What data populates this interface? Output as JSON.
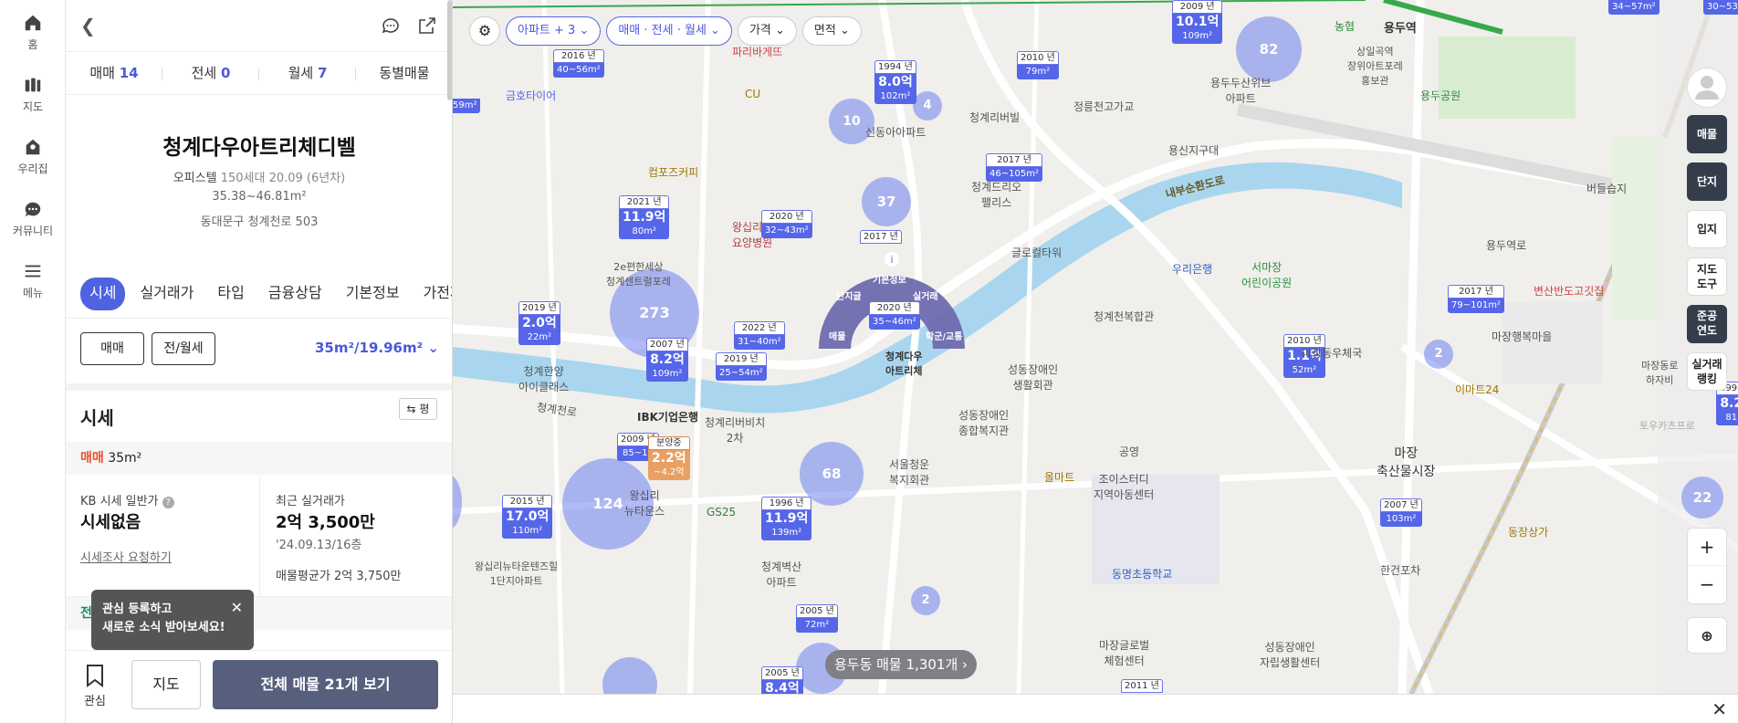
{
  "nav": [
    {
      "label": "홈",
      "icon": "home-icon"
    },
    {
      "label": "지도",
      "icon": "map-icon"
    },
    {
      "label": "우리집",
      "icon": "my-home-icon"
    },
    {
      "label": "커뮤니티",
      "icon": "community-icon"
    },
    {
      "label": "메뉴",
      "icon": "menu-icon"
    }
  ],
  "panel": {
    "deal_tabs": [
      {
        "label": "매매",
        "count": "14"
      },
      {
        "label": "전세",
        "count": "0"
      },
      {
        "label": "월세",
        "count": "7"
      },
      {
        "label": "동별매물",
        "count": ""
      }
    ],
    "title": "청계다우아트리체디벨",
    "meta_type": "오피스텔",
    "meta_rest": "150세대  20.09 (6년차)",
    "area_range": "35.38~46.81m²",
    "address": "동대문구 청계천로 503",
    "info_tabs": [
      "시세",
      "실거래가",
      "타입",
      "금융상담",
      "기본정보",
      "가전제"
    ],
    "btn_sale": "매매",
    "btn_rent": "전/월세",
    "area_select": "35m²/19.96m²",
    "section_title": "시세",
    "pyeong_btn": "평",
    "deal_row_label": "매매",
    "deal_row_area": "35m²",
    "kb_label": "KB 시세 일반가",
    "kb_value": "시세없음",
    "kb_link": "시세조사 요청하기",
    "recent_label": "최근 실거래가",
    "recent_value": "2억 3,500만",
    "recent_date": "'24.09.13/16층",
    "avg_label": "매물평균가",
    "avg_value": "2억 3,750만",
    "rent_row_label": "전세",
    "tooltip_line1": "관심 등록하고",
    "tooltip_line2": "새로운 소식 받아보세요!",
    "fav_label": "관심",
    "map_button": "지도",
    "all_button": "전체 매물 21개 보기"
  },
  "map": {
    "filters": [
      "아파트 + 3",
      "매매 · 전세 · 월세",
      "가격",
      "면적"
    ],
    "right_tools": [
      "매물",
      "단지",
      "입지",
      "지도\n도구",
      "준공\n연도",
      "실거래\n랭킹"
    ],
    "count_pill": "용두동 매물 1,301개",
    "fan_items": [
      "기본정보",
      "단지글",
      "실거래",
      "매물",
      "학군/교통"
    ],
    "fan_center_year": "2020 년",
    "fan_center_area": "35~46m²",
    "selected_name": "청계다우\n아트리체",
    "markers": [
      {
        "year": "2021 년",
        "price": "11.9억",
        "area": "80m²"
      },
      {
        "year": "2019 년",
        "price": "2.0억",
        "area": "22m²"
      },
      {
        "year": "2007 년",
        "price": "8.2억",
        "area": "109m²"
      },
      {
        "year": "2019 년",
        "price": "",
        "area": "25~54m²"
      },
      {
        "year": "2022 년",
        "price": "",
        "area": "31~40m²"
      },
      {
        "year": "2020 년",
        "price": "",
        "area": "32~43m²"
      },
      {
        "year": "1994 년",
        "price": "8.0억",
        "area": "102m²"
      },
      {
        "year": "2009 년",
        "price": "10.1억",
        "area": "109m²"
      },
      {
        "year": "2010 년",
        "price": "",
        "area": "79m²"
      },
      {
        "year": "2017 년",
        "price": "",
        "area": "46~105m²"
      },
      {
        "year": "2017 년",
        "price": "",
        "area": ""
      },
      {
        "year": "2016 년",
        "price": "",
        "area": "40~56m²"
      },
      {
        "year": "2015 년",
        "price": "17.0억",
        "area": "110m²"
      },
      {
        "year": "1996 년",
        "price": "11.9억",
        "area": "139m²"
      },
      {
        "year": "2005 년",
        "price": "",
        "area": "72m²"
      },
      {
        "year": "2005 년",
        "price": "8.4억",
        "area": ""
      },
      {
        "year": "2010 년",
        "price": "1.1억",
        "area": "52m²"
      },
      {
        "year": "2017 년",
        "price": "",
        "area": "79~101m²"
      },
      {
        "year": "2007 년",
        "price": "",
        "area": "103m²"
      },
      {
        "year": "2011 년",
        "price": "",
        "area": ""
      },
      {
        "year": "2009 년",
        "price": "",
        "area": "85~10"
      },
      {
        "year": "분양중",
        "price": "2.2억",
        "area": "~4.2억"
      },
      {
        "year": "",
        "price": "",
        "area": "34~57m²"
      },
      {
        "year": "",
        "price": "",
        "area": "30~53m²"
      },
      {
        "year": "1998",
        "price": "8.2",
        "area": "81"
      },
      {
        "year": "",
        "price": "",
        "area": "59m²"
      }
    ],
    "clusters": [
      "273",
      "124",
      "82",
      "68",
      "37",
      "10",
      "4",
      "2",
      "2",
      "22"
    ],
    "labels": [
      "청계한양\n아이클래스",
      "IBK기업은행",
      "청계리버비치\n2차",
      "왕십리\n요양병원",
      "2e편한세상\n청계센트럴포레",
      "금호타이어",
      "파리바게뜨",
      "CU",
      "컴포즈커피",
      "신동아아파트",
      "청계리버빌",
      "정릉천고가교",
      "용신지구대",
      "상일곡역\n장위아트포레\n홍보관",
      "용두두산위브\n아파트",
      "용두공원",
      "용두역",
      "농협",
      "버들습지",
      "내부순환도로",
      "청계천로",
      "청계천복합관",
      "서마장\n어린이공원",
      "우리은행",
      "글로컬타워",
      "성동장애인\n생활회관",
      "성동장애인\n종합복지관",
      "서울청운\n복지회관",
      "조이스터디\n지역아동센터",
      "공영",
      "올마트",
      "마장\n축산물시장",
      "마장동우체국",
      "이마트24",
      "변산반도고깃집",
      "마장행복마을",
      "동명초등학교",
      "마장글로벌\n체험센터",
      "성동장애인\n자립생활센터",
      "한건포차",
      "동장상가",
      "왕십리\n뉴타운스",
      "왕십리뉴타운텐즈힐\n1단지아파트",
      "청계벽산\n아파트",
      "GS25",
      "용두역로",
      "청계드리오\n팰리스",
      "마장동로\n하자비",
      "토우카츠프로"
    ]
  }
}
